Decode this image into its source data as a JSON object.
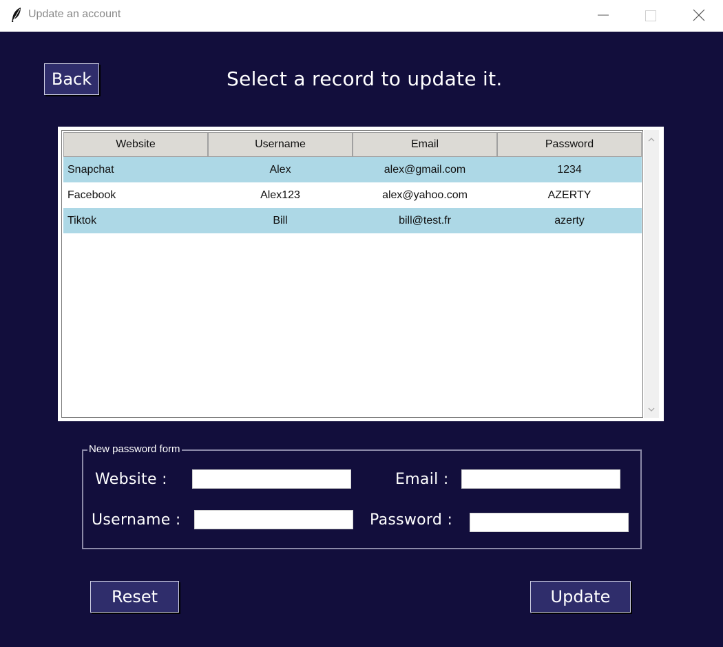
{
  "window": {
    "title": "Update an account",
    "icon": "feather-icon"
  },
  "toolbar": {
    "back_label": "Back",
    "heading": "Select a record to update it."
  },
  "table": {
    "columns": [
      "Website",
      "Username",
      "Email",
      "Password"
    ],
    "rows": [
      {
        "website": "Snapchat",
        "username": "Alex",
        "email": "alex@gmail.com",
        "password": "1234"
      },
      {
        "website": "Facebook",
        "username": "Alex123",
        "email": "alex@yahoo.com",
        "password": "AZERTY"
      },
      {
        "website": "Tiktok",
        "username": "Bill",
        "email": "bill@test.fr",
        "password": "azerty"
      }
    ]
  },
  "form": {
    "legend": "New password form",
    "website_label": "Website :",
    "email_label": "Email :",
    "username_label": "Username :",
    "password_label": "Password :",
    "website_value": "",
    "email_value": "",
    "username_value": "",
    "password_value": ""
  },
  "actions": {
    "reset_label": "Reset",
    "update_label": "Update"
  },
  "colors": {
    "background": "#120e3c",
    "button": "#2f2d6b",
    "row_highlight": "#add8e6",
    "header": "#dcdad5"
  }
}
